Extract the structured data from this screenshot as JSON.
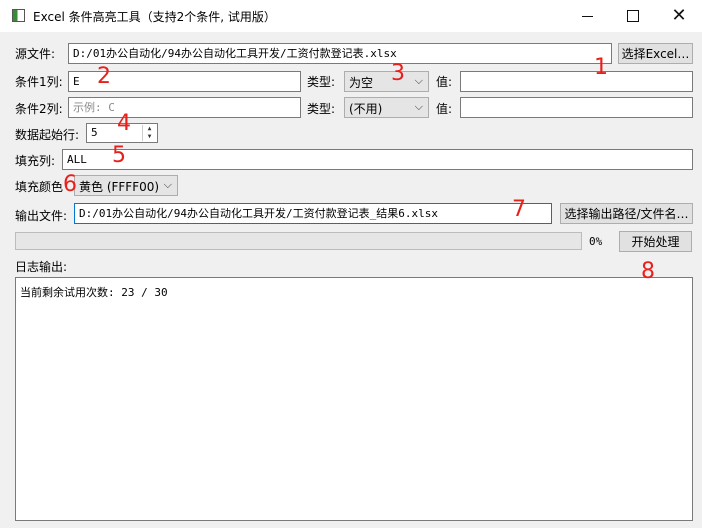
{
  "window": {
    "title": "Excel 条件高亮工具（支持2个条件, 试用版）"
  },
  "source": {
    "label": "源文件:",
    "value": "D:/01办公自动化/94办公自动化工具开发/工资付款登记表.xlsx",
    "button": "选择Excel…"
  },
  "cond1": {
    "label": "条件1列:",
    "value": "E",
    "type_label": "类型:",
    "type_value": "为空",
    "val_label": "值:",
    "val_value": ""
  },
  "cond2": {
    "label": "条件2列:",
    "placeholder": "示例: C",
    "type_label": "类型:",
    "type_value": "(不用)",
    "val_label": "值:",
    "val_value": ""
  },
  "start_row": {
    "label": "数据起始行:",
    "value": "5"
  },
  "fill_col": {
    "label": "填充列:",
    "value": "ALL"
  },
  "fill_color": {
    "label": "填充颜色",
    "value": "黄色 (FFFF00)",
    "hex": "#FFFF00"
  },
  "output": {
    "label": "输出文件:",
    "value": "D:/01办公自动化/94办公自动化工具开发/工资付款登记表_结果6.xlsx",
    "button": "选择输出路径/文件名…"
  },
  "progress": {
    "percent_text": "0%",
    "value": 0,
    "start_button": "开始处理"
  },
  "log": {
    "label": "日志输出:",
    "text": "当前剩余试用次数: 23 / 30"
  },
  "annotations": [
    "1",
    "2",
    "3",
    "4",
    "5",
    "6",
    "7",
    "8"
  ],
  "colors": {
    "annotation": "#e8201c",
    "focus": "#0078d7"
  }
}
